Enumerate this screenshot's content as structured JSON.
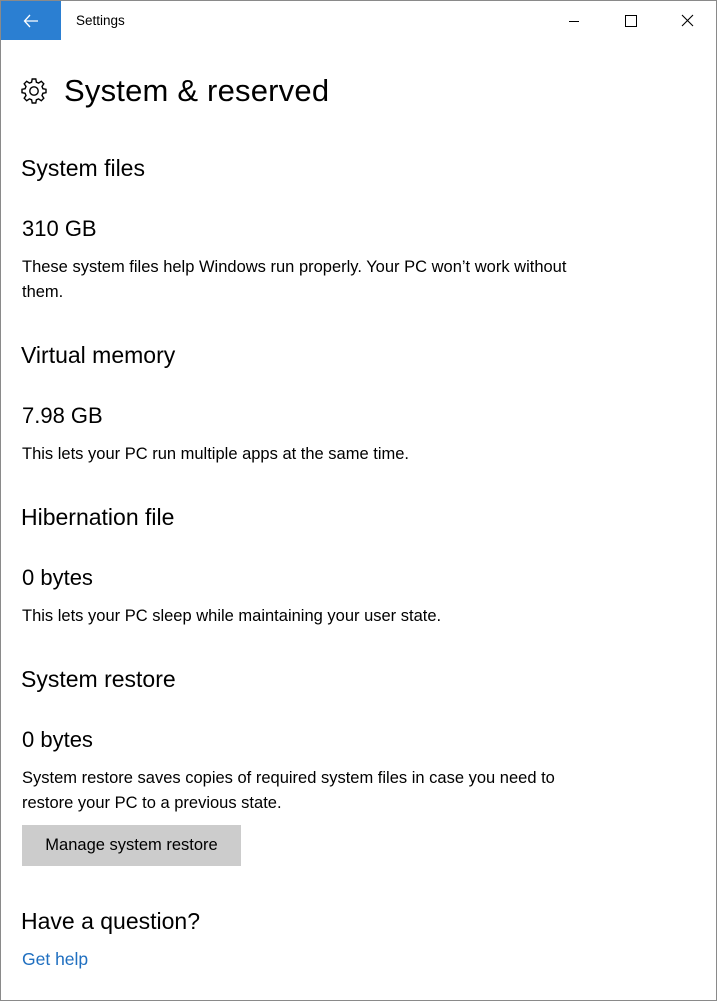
{
  "window": {
    "title": "Settings"
  },
  "page": {
    "title": "System & reserved"
  },
  "sections": [
    {
      "heading": "System files",
      "size": "310 GB",
      "description": "These system files help Windows run properly. Your PC won’t work without them."
    },
    {
      "heading": "Virtual memory",
      "size": "7.98 GB",
      "description": "This lets your PC run multiple apps at the same time."
    },
    {
      "heading": "Hibernation file",
      "size": "0 bytes",
      "description": "This lets your PC sleep while maintaining your user state."
    },
    {
      "heading": "System restore",
      "size": "0 bytes",
      "description": "System restore saves copies of required system files in case you need to restore your PC to a previous state."
    }
  ],
  "restore": {
    "button_label": "Manage system restore"
  },
  "help": {
    "heading": "Have a question?",
    "link_label": "Get help"
  },
  "colors": {
    "accent": "#2b7fd2",
    "link": "#1f6fc0",
    "button_bg": "#cccccc"
  },
  "icons": {
    "back": "back-arrow-icon",
    "minimize": "minimize-icon",
    "maximize": "maximize-icon",
    "close": "close-icon",
    "page": "gear-icon"
  }
}
